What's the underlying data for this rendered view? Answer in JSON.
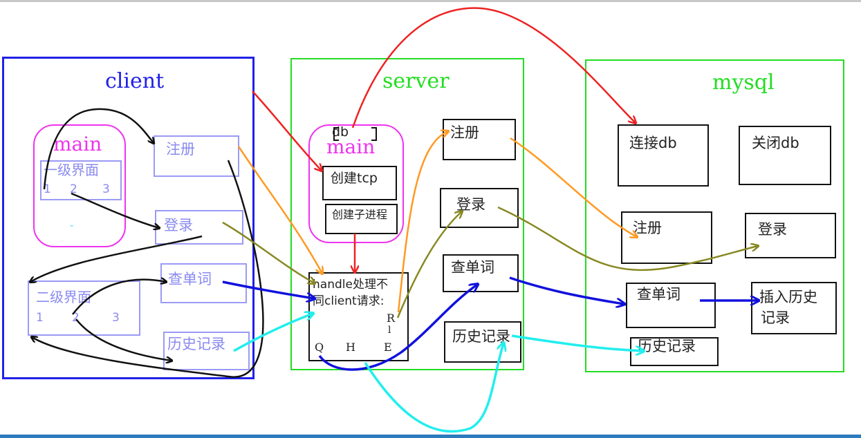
{
  "client": {
    "title": "client",
    "main_label": "main",
    "level1_label": "一级界面",
    "level1_nums": [
      "1",
      "2",
      "3"
    ],
    "dash": "-",
    "register": "注册",
    "login": "登录",
    "level2_label": "二级界面",
    "level2_nums": [
      "1",
      "2",
      "3"
    ],
    "query": "查单词",
    "history": "历史记录"
  },
  "server": {
    "title": "server",
    "db_label": "db",
    "main_label": "main",
    "create_tcp": "创建tcp",
    "create_child": "创建子进程",
    "handle_line1": "handle处理不",
    "handle_line2": "同client请求:",
    "handle_r": "R",
    "handle_l": "l",
    "handle_q": "Q",
    "handle_h": "H",
    "handle_e": "E",
    "register": "注册",
    "login": "登录",
    "query": "查单词",
    "history": "历史记录"
  },
  "mysql": {
    "title": "mysql",
    "connect": "连接db",
    "close": "关闭db",
    "register": "注册",
    "login": "登录",
    "query": "查单词",
    "insert_line1": "插入历史",
    "insert_line2": "记录",
    "history": "历史记录"
  },
  "colors": {
    "client_blue": "#2020e8",
    "server_green": "#22dd22",
    "main_magenta": "#ee33ee",
    "arrow_red": "#ee2222",
    "arrow_orange": "#ff9922",
    "arrow_olive": "#888822",
    "arrow_blue": "#1111dd",
    "arrow_cyan": "#22eeee",
    "arrow_black": "#111111"
  }
}
